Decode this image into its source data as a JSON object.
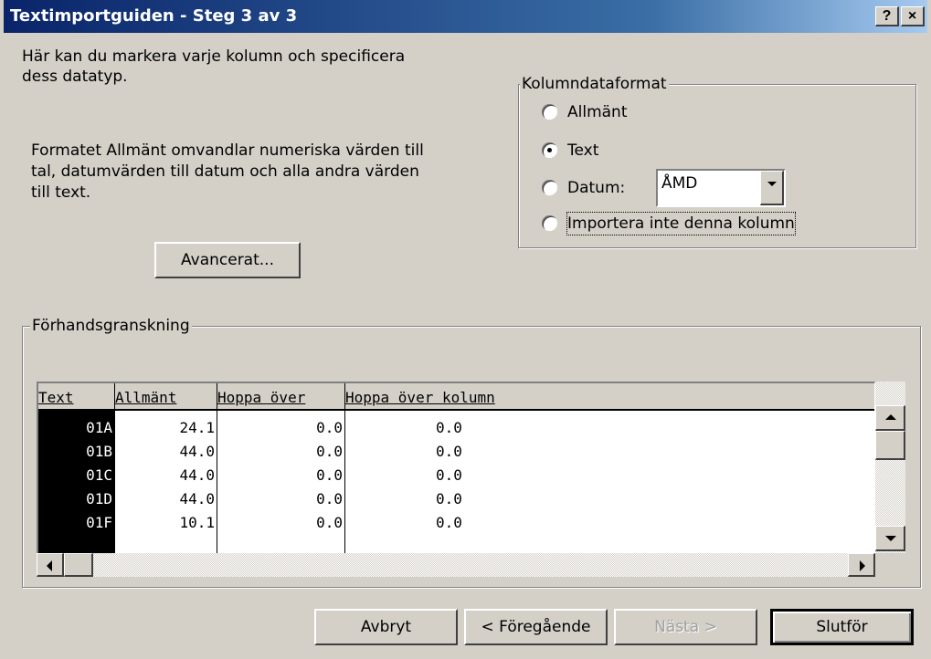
{
  "window": {
    "title": "Textimportguiden - Steg 3 av 3",
    "help_label": "?",
    "close_label": "×"
  },
  "intro": {
    "line1": "Här kan du markera varje kolumn och specificera",
    "line2": "dess datatyp."
  },
  "description": {
    "line1": "Formatet Allmänt omvandlar numeriska värden till",
    "line2": "tal, datumvärden till datum och alla andra värden",
    "line3": "till text."
  },
  "advanced_button": "Avancerat...",
  "format_group": {
    "title": "Kolumndataformat",
    "options": [
      {
        "label": "Allmänt",
        "checked": false
      },
      {
        "label": "Text",
        "checked": true
      },
      {
        "label": "Datum:",
        "checked": false
      },
      {
        "label": "Importera inte denna kolumn",
        "checked": false
      }
    ],
    "date_format": "ÅMD"
  },
  "preview": {
    "title": "Förhandsgranskning",
    "headers": [
      "Text",
      "Allmänt",
      "Hoppa över",
      "Hoppa över kolumn"
    ],
    "rows": [
      [
        "01A",
        "24.1",
        "0.0",
        "0.0"
      ],
      [
        "01B",
        "44.0",
        "0.0",
        "0.0"
      ],
      [
        "01C",
        "44.0",
        "0.0",
        "0.0"
      ],
      [
        "01D",
        "44.0",
        "0.0",
        "0.0"
      ],
      [
        "01F",
        "10.1",
        "0.0",
        "0.0"
      ]
    ]
  },
  "buttons": {
    "cancel": "Avbryt",
    "back": "< Föregående",
    "next": "Nästa >",
    "finish": "Slutför"
  },
  "colors": {
    "title_start": "#0a246a",
    "title_end": "#a6caf0",
    "face": "#d4d0c8",
    "selected_column": "#000000"
  }
}
